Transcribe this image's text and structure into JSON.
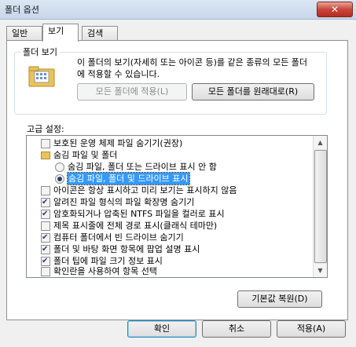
{
  "window": {
    "title": "폴더 옵션",
    "close_glyph": "✕"
  },
  "tabs": [
    {
      "label": "일반"
    },
    {
      "label": "보기"
    },
    {
      "label": "검색"
    }
  ],
  "folder_views": {
    "title": "폴더 보기",
    "description": "이 폴더의 보기(자세히 또는 아이콘 등)를 같은 종류의 모든 폴더에 적용할 수 있습니다.",
    "apply_button": "모든 폴더에 적용(L)",
    "reset_button": "모든 폴더를 원래대로(R)"
  },
  "advanced": {
    "label": "고급 설정:",
    "items": [
      {
        "type": "checkbox",
        "checked": false,
        "label": "보호된 운영 체제 파일 숨기기(권장)"
      },
      {
        "type": "folder",
        "label": "숨김 파일 및 폴더"
      },
      {
        "type": "radio",
        "checked": false,
        "label": "숨김 파일, 폴더 또는 드라이브 표시 안 함"
      },
      {
        "type": "radio",
        "checked": true,
        "label": "숨김 파일, 폴더 및 드라이브 표시"
      },
      {
        "type": "checkbox",
        "checked": false,
        "label": "아이콘은 항상 표시하고 미리 보기는 표시하지 않음"
      },
      {
        "type": "checkbox",
        "checked": true,
        "label": "알려진 파일 형식의 파일 확장명 숨기기"
      },
      {
        "type": "checkbox",
        "checked": true,
        "label": "암호화되거나 압축된 NTFS 파일을 컬러로 표시"
      },
      {
        "type": "checkbox",
        "checked": false,
        "label": "제목 표시줄에 전체 경로 표시(클래식 테마만)"
      },
      {
        "type": "checkbox",
        "checked": true,
        "label": "컴퓨터 폴더에서 빈 드라이브 숨기기"
      },
      {
        "type": "checkbox",
        "checked": true,
        "label": "폴더 및 바탕 화면 항목에 팝업 설명 표시"
      },
      {
        "type": "checkbox",
        "checked": true,
        "label": "폴더 팁에 파일 크기 정보 표시"
      },
      {
        "type": "checkbox",
        "checked": false,
        "label": "확인란을 사용하여 항목 선택"
      }
    ],
    "restore_defaults": "기본값 복원(D)"
  },
  "footer": {
    "ok": "확인",
    "cancel": "취소",
    "apply": "적용(A)"
  }
}
